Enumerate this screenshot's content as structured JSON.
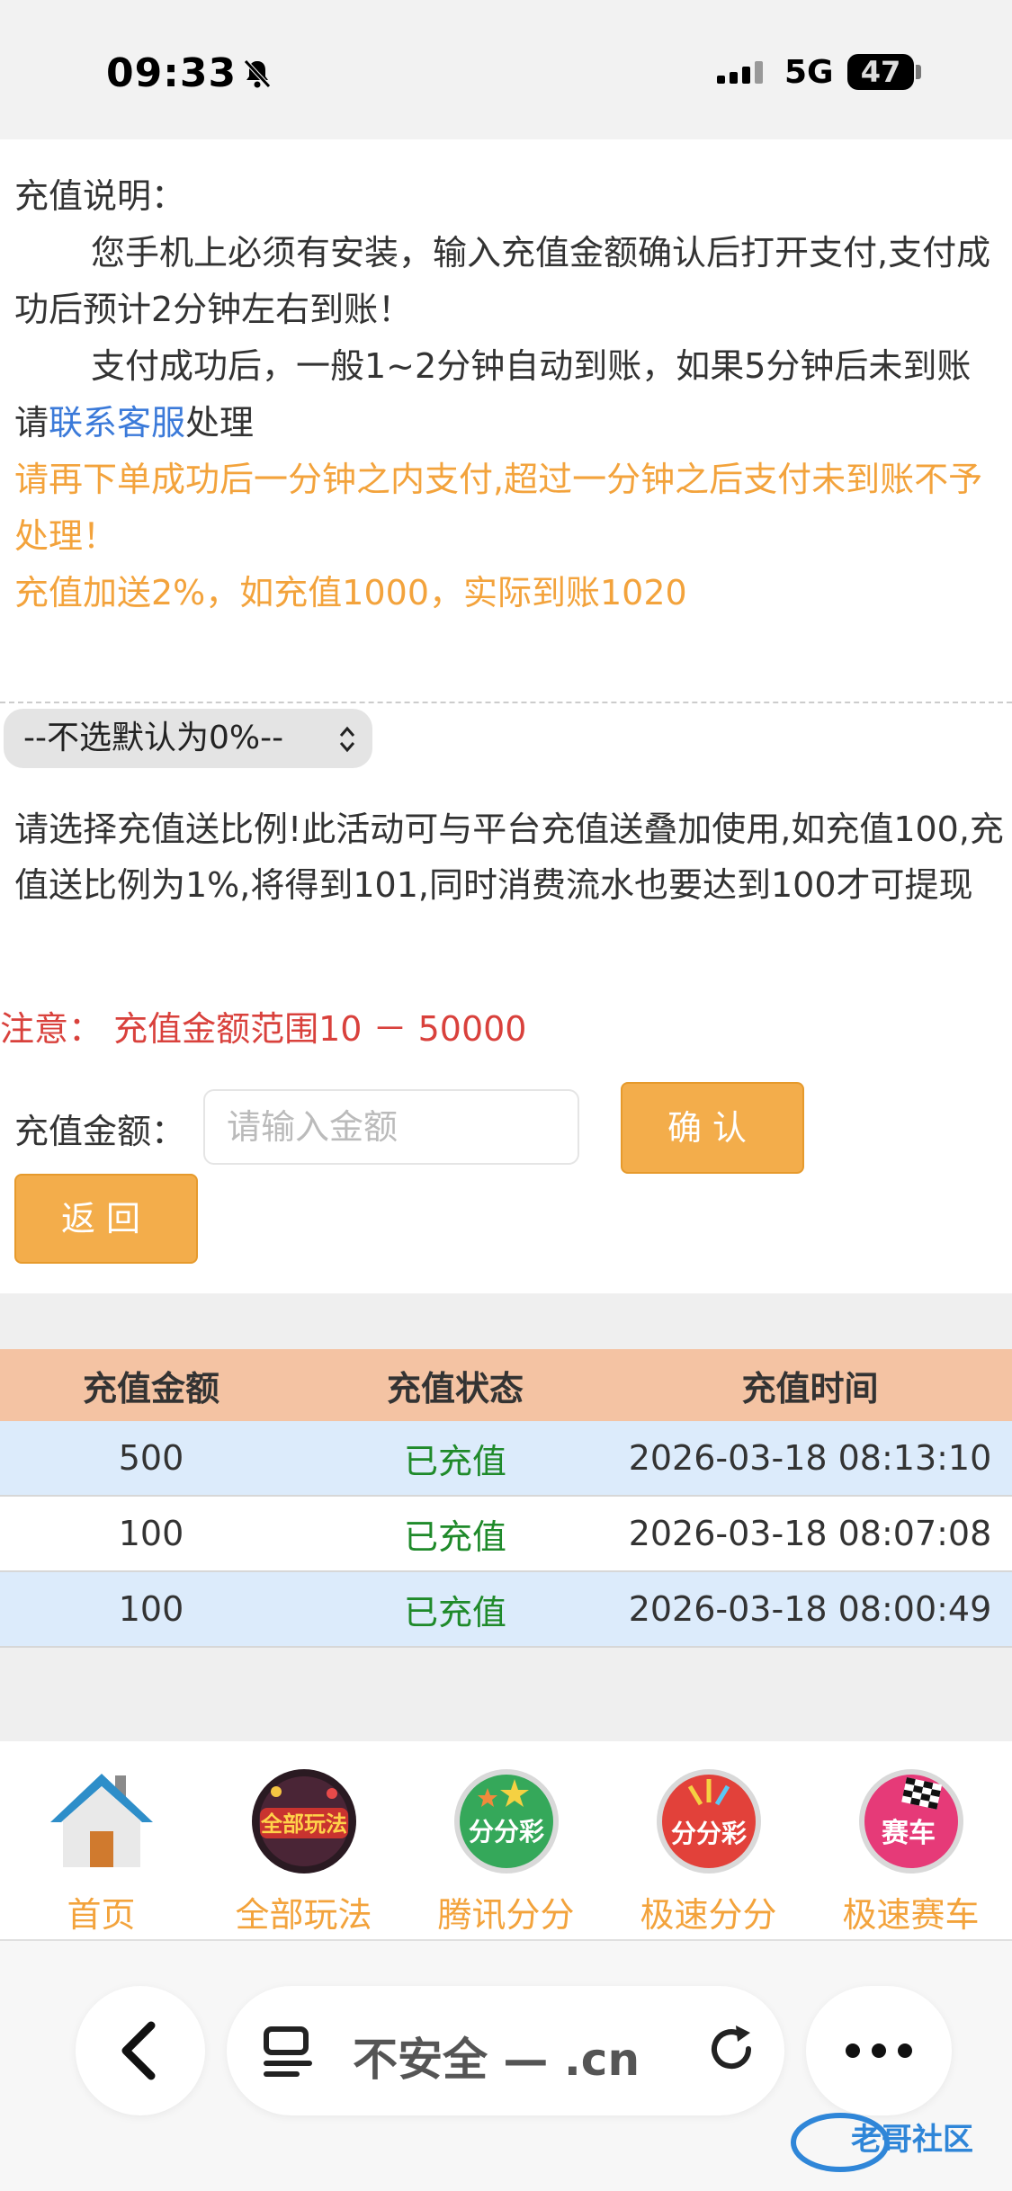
{
  "status_bar": {
    "time": "09:33",
    "network": "5G",
    "battery": "47"
  },
  "notes": {
    "title": "充值说明：",
    "line1": "您手机上必须有安装，输入充值金额确认后打开支付,支付成功后预计2分钟左右到账！",
    "line2_before": "支付成功后，一般1~2分钟自动到账，如果5分钟后未到账请",
    "line2_link": "联系客服",
    "line2_after": "处理",
    "warning": "请再下单成功后一分钟之内支付,超过一分钟之后支付未到账不予处理！",
    "bonus": "充值加送2%，如充值1000，实际到账1020"
  },
  "ratio_select": {
    "selected": "--不选默认为0%--"
  },
  "activity_text": "请选择充值送比例!此活动可与平台充值送叠加使用,如充值100,充值送比例为1%,将得到101,同时消费流水也要达到100才可提现",
  "notice": "注意：  充值金额范围10 － 50000",
  "form": {
    "amount_label": "充值金额：",
    "amount_placeholder": "请输入金额",
    "confirm_label": "确认",
    "back_label": "返回"
  },
  "records": {
    "headers": [
      "充值金额",
      "充值状态",
      "充值时间"
    ],
    "rows": [
      {
        "amount": "500",
        "status": "已充值",
        "time": "2026-03-18 08:13:10"
      },
      {
        "amount": "100",
        "status": "已充值",
        "time": "2026-03-18 08:07:08"
      },
      {
        "amount": "100",
        "status": "已充值",
        "time": "2026-03-18 08:00:49"
      }
    ]
  },
  "bottom_nav": {
    "items": [
      {
        "label": "首页",
        "icon": "house-icon"
      },
      {
        "label": "全部玩法",
        "icon": "all-games-icon",
        "badge": "全部玩法"
      },
      {
        "label": "腾讯分分",
        "icon": "tencent-ffc-icon",
        "badge": "分分彩"
      },
      {
        "label": "极速分分",
        "icon": "speed-ffc-icon",
        "badge": "分分彩"
      },
      {
        "label": "极速赛车",
        "icon": "speed-racing-icon",
        "badge": "赛车"
      }
    ]
  },
  "browser": {
    "url_text": "不安全 — .cn"
  },
  "colors": {
    "accent_orange": "#f3a33c",
    "link_blue": "#3b7ad9",
    "notice_red": "#d9413c",
    "status_green": "#1f8a2a",
    "table_header": "#f4c3a3",
    "row_alt": "#dcebfb"
  }
}
